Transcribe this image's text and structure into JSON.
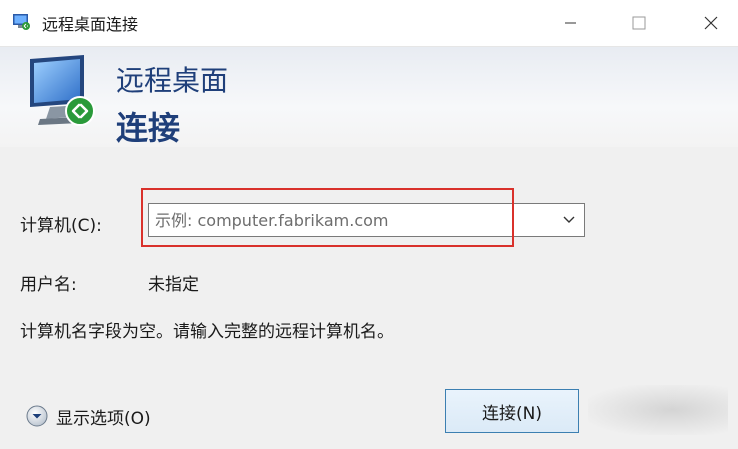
{
  "window": {
    "title": "远程桌面连接",
    "controls": [
      "minimize",
      "maximize",
      "close"
    ]
  },
  "banner": {
    "line1": "远程桌面",
    "line2": "连接"
  },
  "form": {
    "computer_label": "计算机(C):",
    "computer_placeholder": "示例: computer.fabrikam.com",
    "computer_value": "",
    "user_label": "用户名:",
    "user_value": "未指定",
    "message": "计算机名字段为空。请输入完整的远程计算机名。"
  },
  "footer": {
    "options_label": "显示选项(O)",
    "connect_label": "连接(N)"
  },
  "colors": {
    "banner_text": "#1f3f7a",
    "highlight": "#d9312b",
    "button_border": "#3c7fb1"
  },
  "icons": [
    "rdp-app-icon",
    "rdp-monitor-icon",
    "chevron-down-icon",
    "expand-options-icon"
  ]
}
